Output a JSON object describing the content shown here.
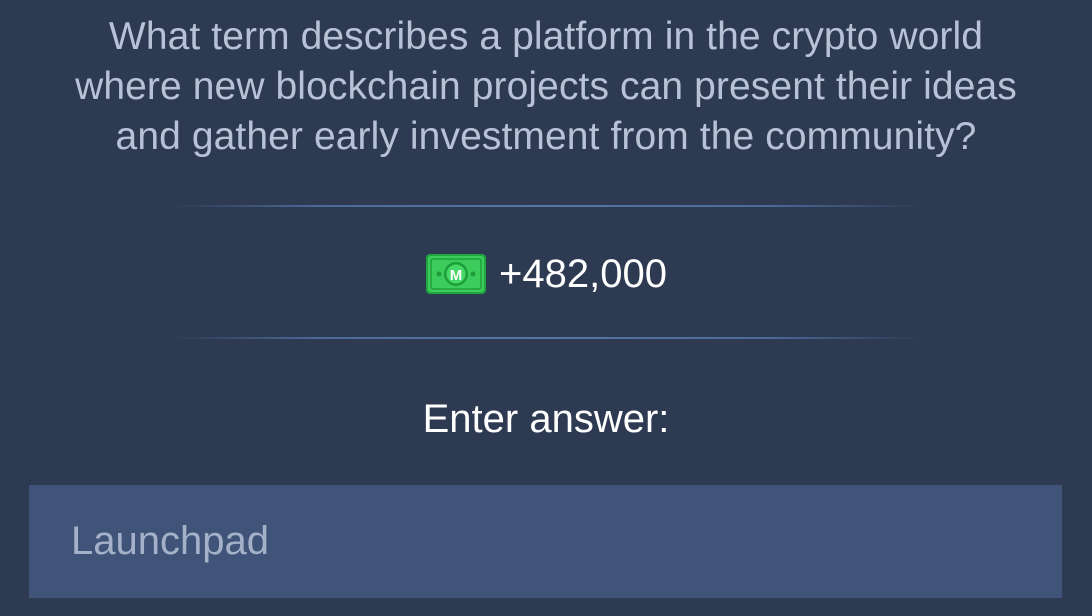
{
  "question": {
    "line1": "What term describes a platform in the crypto world",
    "line2": "where new blockchain projects can present their ideas",
    "line3": "and gather early investment from the community?"
  },
  "reward": {
    "icon": "money-bill-icon",
    "icon_letter": "M",
    "value": "+482,000",
    "icon_color": "#39c95a"
  },
  "prompt": "Enter answer:",
  "answer_input": {
    "value": "Launchpad"
  },
  "colors": {
    "background": "#2d3a52",
    "input_background": "#3f5478",
    "question_text": "#b7c2d6"
  }
}
